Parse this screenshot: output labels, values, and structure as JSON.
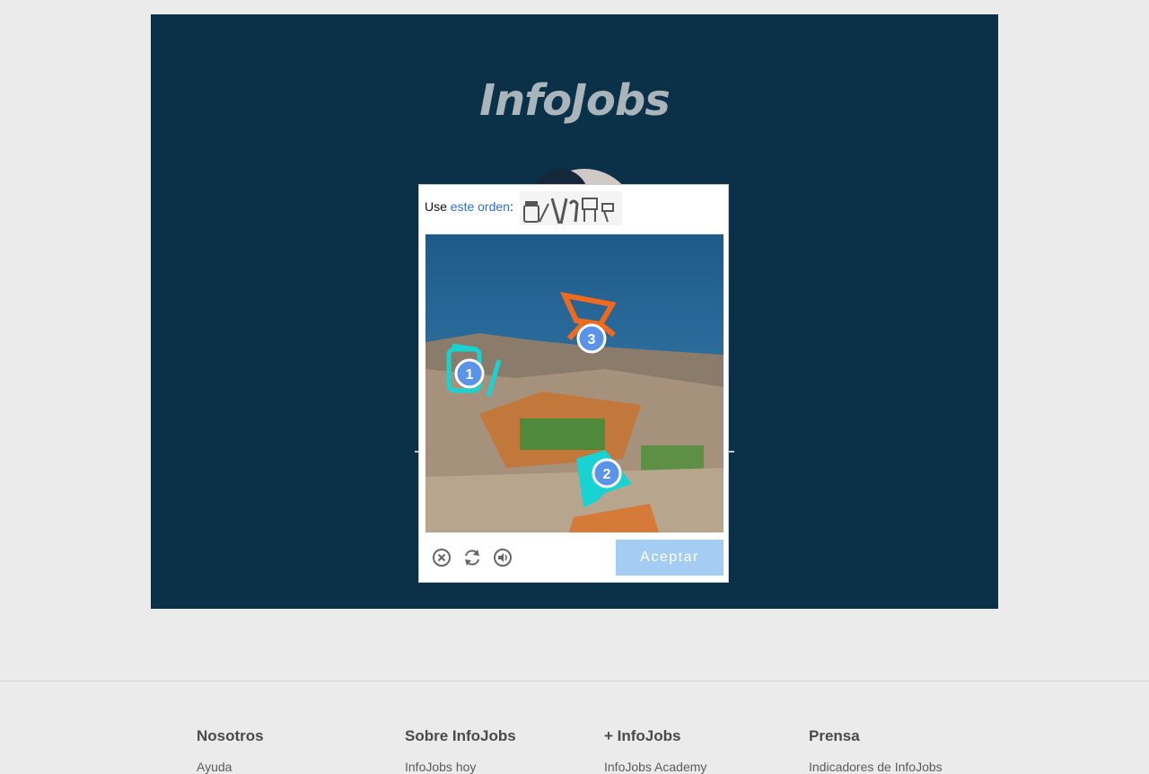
{
  "brand": {
    "logo_text": "InfoJobs"
  },
  "captcha": {
    "prompt_prefix": "Use ",
    "prompt_link": "este orden",
    "prompt_suffix": ":",
    "markers": [
      "1",
      "2",
      "3"
    ],
    "accept_label": "Aceptar",
    "tools": [
      "close-icon",
      "refresh-icon",
      "audio-icon"
    ],
    "accent_color": "#a5cdf3"
  },
  "footer": {
    "columns": [
      {
        "title": "Nosotros",
        "first_link": "Ayuda"
      },
      {
        "title": "Sobre InfoJobs",
        "first_link": "InfoJobs hoy"
      },
      {
        "title": "+ InfoJobs",
        "first_link": "InfoJobs Academy"
      },
      {
        "title": "Prensa",
        "first_link": "Indicadores de InfoJobs"
      }
    ]
  }
}
